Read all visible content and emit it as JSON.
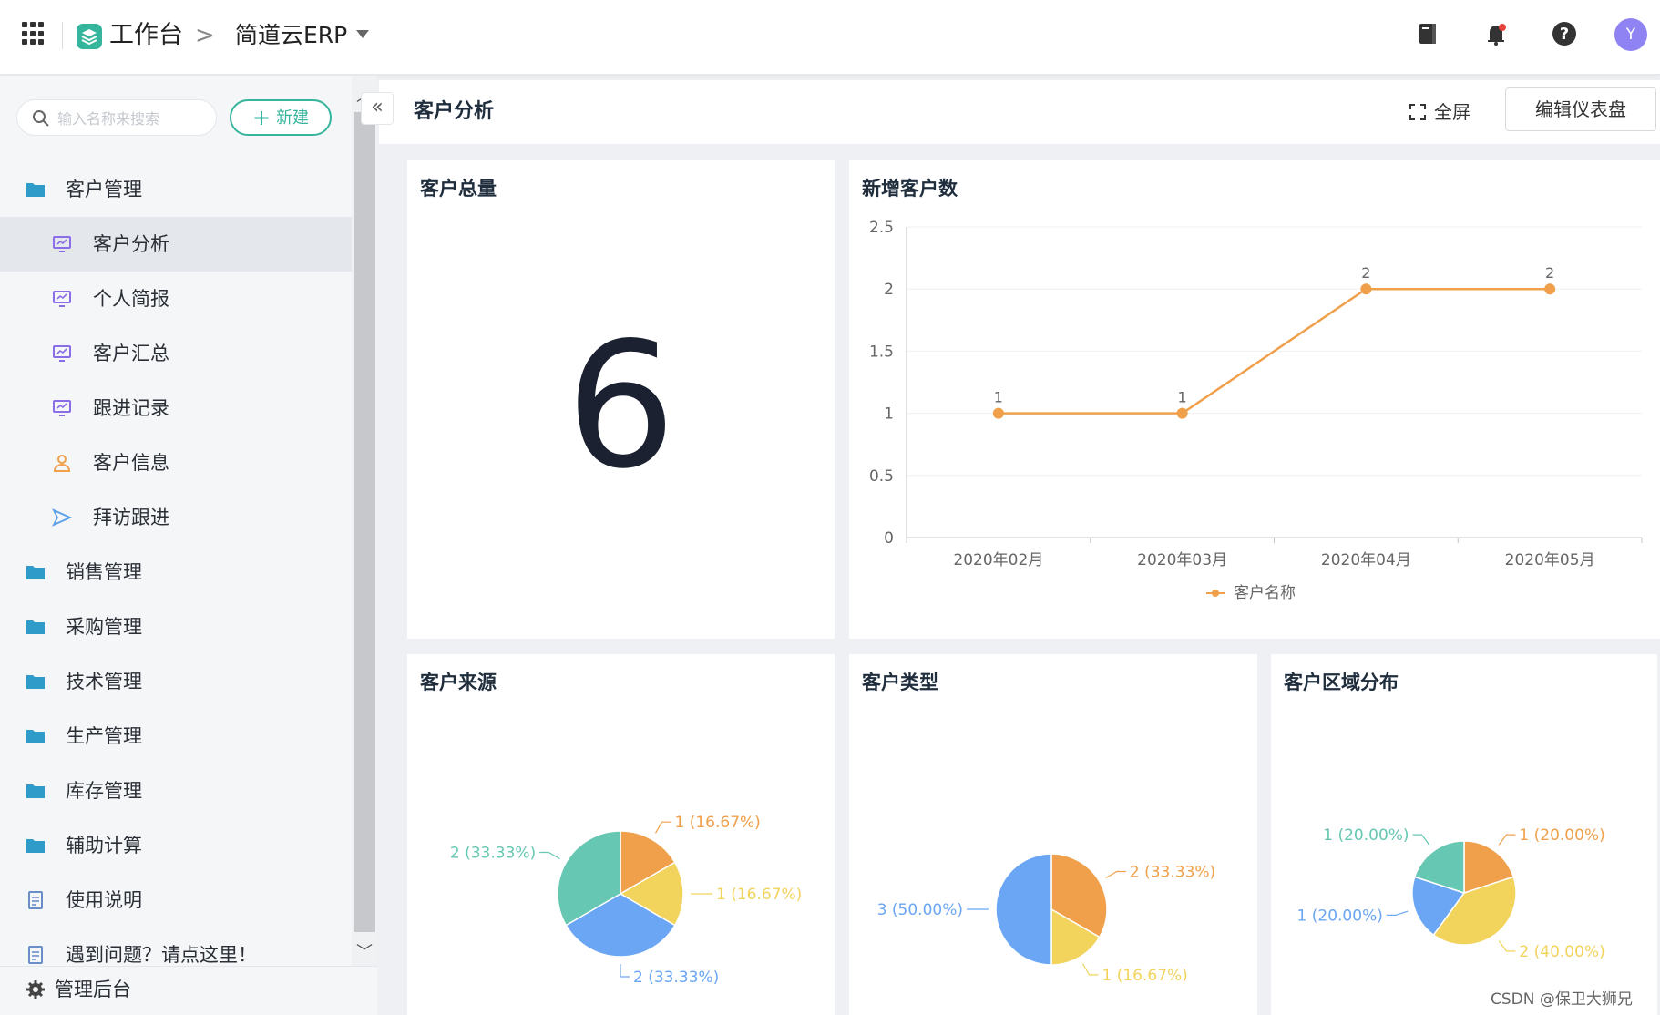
{
  "topbar": {
    "workspace_title": "工作台",
    "breadcrumb_separator": ">",
    "app_name": "简道云ERP",
    "avatar_letter": "Y",
    "icons": [
      "apps-grid-icon",
      "workspace-logo-icon",
      "notebook-icon",
      "bell-icon",
      "help-icon"
    ]
  },
  "sidebar": {
    "search_placeholder": "输入名称来搜索",
    "new_button": "新建",
    "items": [
      {
        "label": "客户管理",
        "type": "group",
        "icon": "folder-icon"
      },
      {
        "label": "客户分析",
        "type": "child",
        "icon": "dashboard-icon",
        "active": true
      },
      {
        "label": "个人简报",
        "type": "child",
        "icon": "dashboard-icon"
      },
      {
        "label": "客户汇总",
        "type": "child",
        "icon": "dashboard-icon"
      },
      {
        "label": "跟进记录",
        "type": "child",
        "icon": "dashboard-icon"
      },
      {
        "label": "客户信息",
        "type": "child",
        "icon": "person-icon"
      },
      {
        "label": "拜访跟进",
        "type": "child",
        "icon": "send-icon"
      },
      {
        "label": "销售管理",
        "type": "group",
        "icon": "folder-icon"
      },
      {
        "label": "采购管理",
        "type": "group",
        "icon": "folder-icon"
      },
      {
        "label": "技术管理",
        "type": "group",
        "icon": "folder-icon"
      },
      {
        "label": "生产管理",
        "type": "group",
        "icon": "folder-icon"
      },
      {
        "label": "库存管理",
        "type": "group",
        "icon": "folder-icon"
      },
      {
        "label": "辅助计算",
        "type": "group",
        "icon": "folder-icon"
      },
      {
        "label": "使用说明",
        "type": "group",
        "icon": "document-icon"
      },
      {
        "label": "遇到问题？请点这里！",
        "type": "group",
        "icon": "document-icon"
      }
    ],
    "admin_label": "管理后台"
  },
  "main": {
    "page_title": "客户分析",
    "fullscreen_label": "全屏",
    "edit_button": "编辑仪表盘"
  },
  "cards": {
    "total": {
      "title": "客户总量",
      "value": "6"
    },
    "new_customers": {
      "title": "新增客户数"
    },
    "source": {
      "title": "客户来源"
    },
    "type": {
      "title": "客户类型"
    },
    "region": {
      "title": "客户区域分布"
    }
  },
  "colors": {
    "accent": "#36b59d",
    "line": "#f0a04b",
    "pie_orange": "#f0a04b",
    "pie_yellow": "#f2d35c",
    "pie_blue": "#6aa6f4",
    "pie_teal": "#66c7b2"
  },
  "chart_data": [
    {
      "type": "line",
      "title": "新增客户数",
      "categories": [
        "2020年02月",
        "2020年03月",
        "2020年04月",
        "2020年05月"
      ],
      "series": [
        {
          "name": "客户名称",
          "values": [
            1,
            1,
            2,
            2
          ]
        }
      ],
      "ylim": [
        0,
        2.5
      ],
      "yticks": [
        "0",
        "0.5",
        "1",
        "1.5",
        "2",
        "2.5"
      ],
      "legend": "bottom",
      "grid": true
    },
    {
      "type": "pie",
      "title": "客户来源",
      "slices": [
        {
          "value": 1,
          "label": "1 (16.67%)",
          "color": "#f0a04b"
        },
        {
          "value": 1,
          "label": "1 (16.67%)",
          "color": "#f2d35c"
        },
        {
          "value": 2,
          "label": "2 (33.33%)",
          "color": "#6aa6f4"
        },
        {
          "value": 2,
          "label": "2 (33.33%)",
          "color": "#66c7b2"
        }
      ]
    },
    {
      "type": "pie",
      "title": "客户类型",
      "slices": [
        {
          "value": 2,
          "label": "2 (33.33%)",
          "color": "#f0a04b"
        },
        {
          "value": 1,
          "label": "1 (16.67%)",
          "color": "#f2d35c"
        },
        {
          "value": 3,
          "label": "3 (50.00%)",
          "color": "#6aa6f4"
        }
      ]
    },
    {
      "type": "pie",
      "title": "客户区域分布",
      "slices": [
        {
          "value": 1,
          "label": "1 (20.00%)",
          "color": "#f0a04b"
        },
        {
          "value": 2,
          "label": "2 (40.00%)",
          "color": "#f2d35c"
        },
        {
          "value": 1,
          "label": "1 (20.00%)",
          "color": "#6aa6f4"
        },
        {
          "value": 1,
          "label": "1 (20.00%)",
          "color": "#66c7b2"
        }
      ]
    }
  ],
  "watermark": "CSDN @保卫大狮兄"
}
